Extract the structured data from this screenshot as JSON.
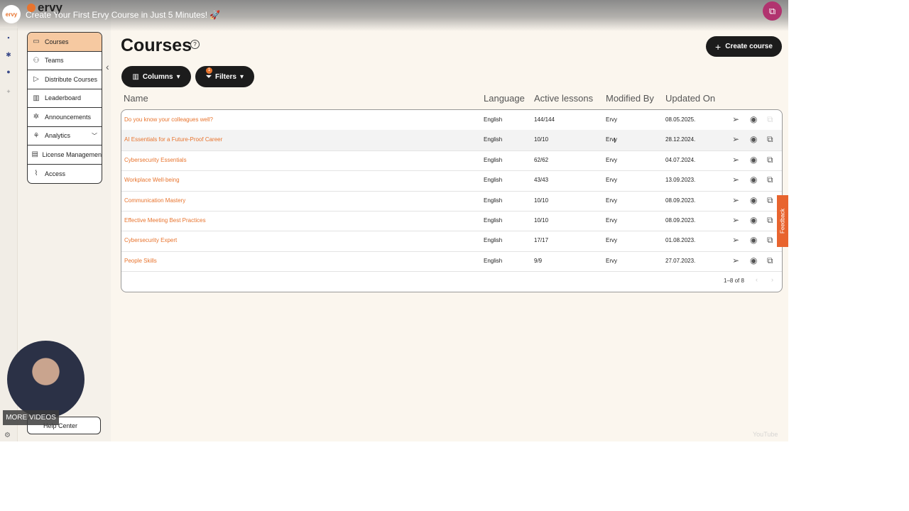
{
  "video": {
    "title": "Create Your First Ervy Course in Just 5 Minutes! 🚀",
    "channel_logo": "ervy",
    "brand": "ervy",
    "more_videos": "MORE VIDEOS",
    "watermark": "YouTube"
  },
  "sidebar": {
    "items": [
      {
        "label": "Courses",
        "icon": "book-icon"
      },
      {
        "label": "Teams",
        "icon": "users-icon"
      },
      {
        "label": "Distribute Courses",
        "icon": "send-icon"
      },
      {
        "label": "Leaderboard",
        "icon": "chart-icon"
      },
      {
        "label": "Announcements",
        "icon": "bell-icon"
      },
      {
        "label": "Analytics",
        "icon": "analytics-icon"
      },
      {
        "label": "License Managemen",
        "icon": "license-icon"
      },
      {
        "label": "Access",
        "icon": "thermometer-icon"
      }
    ],
    "help": "Help Center"
  },
  "page": {
    "title": "Courses",
    "create": "Create course",
    "columns": "Columns",
    "filters": "Filters",
    "filter_count": "1"
  },
  "table": {
    "headers": [
      "Name",
      "Language",
      "Active lessons",
      "Modified By",
      "Updated On"
    ],
    "rows": [
      {
        "name": "Do you know your colleagues well?",
        "language": "English",
        "lessons": "144/144",
        "by": "Ervy",
        "updated": "08.05.2025."
      },
      {
        "name": "AI Essentials for a Future-Proof Career",
        "language": "English",
        "lessons": "10/10",
        "by": "Ervy",
        "updated": "28.12.2024."
      },
      {
        "name": "Cybersecurity Essentials",
        "language": "English",
        "lessons": "62/62",
        "by": "Ervy",
        "updated": "04.07.2024."
      },
      {
        "name": "Workplace Well-being",
        "language": "English",
        "lessons": "43/43",
        "by": "Ervy",
        "updated": "13.09.2023."
      },
      {
        "name": "Communication Mastery",
        "language": "English",
        "lessons": "10/10",
        "by": "Ervy",
        "updated": "08.09.2023."
      },
      {
        "name": "Effective Meeting Best Practices",
        "language": "English",
        "lessons": "10/10",
        "by": "Ervy",
        "updated": "08.09.2023."
      },
      {
        "name": "Cybersecurity Expert",
        "language": "English",
        "lessons": "17/17",
        "by": "Ervy",
        "updated": "01.08.2023."
      },
      {
        "name": "People Skills",
        "language": "English",
        "lessons": "9/9",
        "by": "Ervy",
        "updated": "27.07.2023."
      }
    ],
    "pagination": "1–8 of 8"
  },
  "feedback": "Feedback",
  "colors": {
    "accent": "#e8742e",
    "dark": "#1c1c1c",
    "active": "#f6c9a1"
  }
}
